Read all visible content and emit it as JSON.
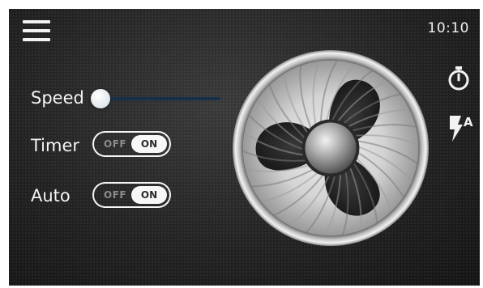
{
  "header": {
    "time": "10:10",
    "menu_icon": "hamburger-menu-icon"
  },
  "controls": {
    "speed": {
      "label": "Speed",
      "value": 0.0
    },
    "timer": {
      "label": "Timer",
      "off_label": "OFF",
      "on_label": "ON",
      "state": "on"
    },
    "auto": {
      "label": "Auto",
      "off_label": "OFF",
      "on_label": "ON",
      "state": "on"
    }
  },
  "side_icons": [
    {
      "name": "stopwatch-icon"
    },
    {
      "name": "auto-flash-icon",
      "text": "A"
    }
  ],
  "colors": {
    "slider_track": "#173049",
    "text": "#f4f4f4",
    "background": "#232323"
  }
}
